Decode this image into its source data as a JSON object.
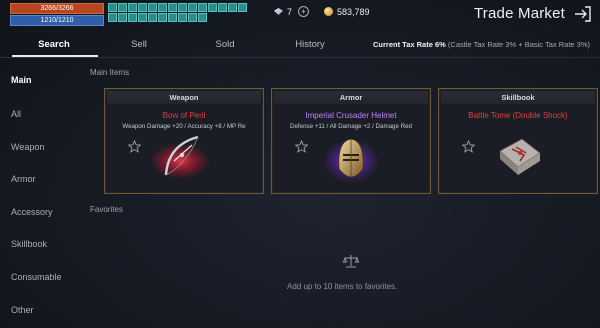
{
  "hud": {
    "hp_text": "3266/3266",
    "mp_text": "1210/1210",
    "buff_count": 24,
    "gem_count": "7",
    "gold": "583,789"
  },
  "header": {
    "title": "Trade Market"
  },
  "tabs": [
    "Search",
    "Sell",
    "Sold",
    "History"
  ],
  "tax": {
    "label": "Current Tax Rate",
    "value": "6%",
    "detail": "(Castle Tax Rate 3% + Basic Tax Rate 3%)"
  },
  "sidebar": [
    "Main",
    "All",
    "Weapon",
    "Armor",
    "Accessory",
    "Skillbook",
    "Consumable",
    "Other"
  ],
  "main_items": {
    "label": "Main Items",
    "cards": [
      {
        "category": "Weapon",
        "name": "Bow of Peril",
        "stats": "Weapon Damage +20 / Accuracy +8 / MP Re",
        "color": "#e0413b",
        "icon": "bow-icon"
      },
      {
        "category": "Armor",
        "name": "Imperial Crusader Helmet",
        "stats": "Defense +11 / All Damage +2 / Damage Red",
        "color": "#c080ff",
        "icon": "helmet-icon"
      },
      {
        "category": "Skillbook",
        "name": "Battle Tome (Double Shock)",
        "stats": "",
        "color": "#e0413b",
        "icon": "tome-icon"
      }
    ]
  },
  "favorites": {
    "label": "Favorites",
    "hint": "Add up to 10 items to favorites."
  }
}
